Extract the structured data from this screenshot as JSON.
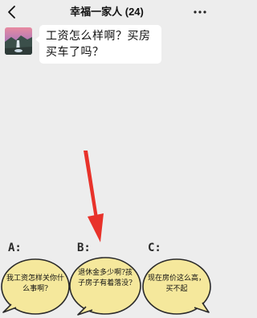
{
  "header": {
    "title": "幸福一家人 (24)",
    "back_icon": "chevron-left-icon",
    "more_icon": "more-dots-icon"
  },
  "message": {
    "text": "工资怎么样啊？买房买车了吗？",
    "avatar_icon": "landscape-avatar"
  },
  "options": [
    {
      "label": "A:",
      "text": "我工资怎样关你什么事啊?"
    },
    {
      "label": "B:",
      "text": "退休金多少啊?孩子房子有着落没?"
    },
    {
      "label": "C:",
      "text": "现在房价这么高，买不起"
    }
  ],
  "colors": {
    "background": "#ededed",
    "option_bubble": "#f5e89c",
    "arrow": "#e8322a"
  }
}
